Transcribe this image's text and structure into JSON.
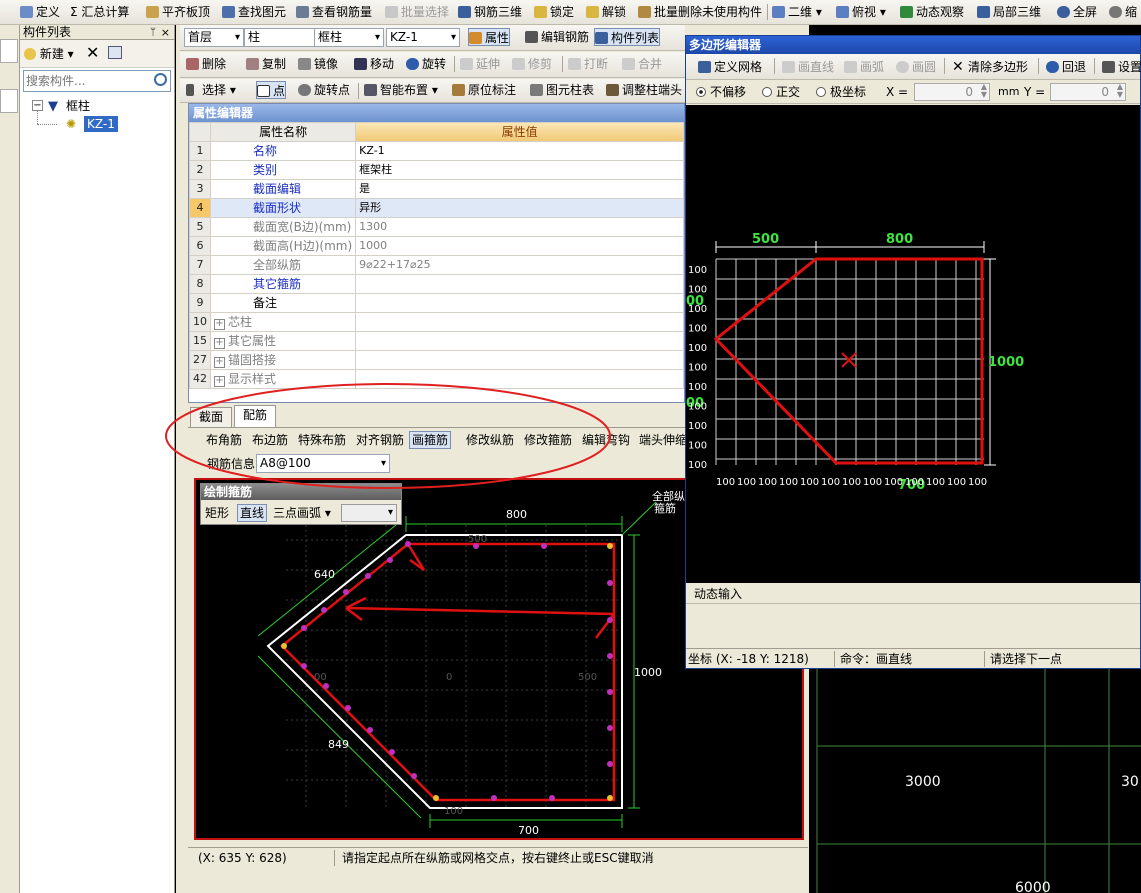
{
  "top_toolbar": {
    "items": [
      {
        "label": "定义",
        "icon": "define-icon"
      },
      {
        "label": "Σ 汇总计算",
        "icon": "sum-icon"
      },
      {
        "label": "平齐板顶",
        "icon": "align-slab-icon"
      },
      {
        "label": "查找图元",
        "icon": "find-icon"
      },
      {
        "label": "查看钢筋量",
        "icon": "view-rebar-icon"
      },
      {
        "label": "批量选择",
        "icon": "batch-select-icon",
        "disabled": true
      },
      {
        "label": "钢筋三维",
        "icon": "rebar-3d-icon"
      },
      {
        "label": "锁定",
        "icon": "lock-icon"
      },
      {
        "label": "解锁",
        "icon": "unlock-icon"
      },
      {
        "label": "批量删除未使用构件",
        "icon": "batch-delete-icon"
      },
      {
        "label": "二维",
        "icon": "2d-icon"
      },
      {
        "label": "俯视",
        "icon": "top-view-icon"
      },
      {
        "label": "动态观察",
        "icon": "orbit-icon"
      },
      {
        "label": "局部三维",
        "icon": "local-3d-icon"
      },
      {
        "label": "全屏",
        "icon": "fullscreen-icon"
      },
      {
        "label": "缩",
        "icon": "zoom-icon"
      }
    ]
  },
  "left_panel": {
    "title": "构件列表",
    "new_label": "新建",
    "search_placeholder": "搜索构件...",
    "tree_root": "框柱",
    "tree_child": "KZ-1"
  },
  "second_toolbar": {
    "floor": "首层",
    "type": "柱",
    "subtype": "框柱",
    "component": "KZ-1",
    "btn_props": "属性",
    "btn_edit_rebar": "编辑钢筋",
    "btn_component_list": "构件列表"
  },
  "third_toolbar": {
    "items": [
      "删除",
      "复制",
      "镜像",
      "移动",
      "旋转",
      "延伸",
      "修剪",
      "打断",
      "合并"
    ]
  },
  "fourth_toolbar": {
    "items": [
      "选择",
      "点",
      "旋转点",
      "智能布置",
      "原位标注",
      "图元柱表",
      "调整柱端头"
    ]
  },
  "property_editor": {
    "title": "属性编辑器",
    "col_name": "属性名称",
    "col_value": "属性值",
    "rows": [
      {
        "num": "1",
        "name": "名称",
        "value": "KZ-1",
        "style": "blue"
      },
      {
        "num": "2",
        "name": "类别",
        "value": "框架柱",
        "style": "blue"
      },
      {
        "num": "3",
        "name": "截面编辑",
        "value": "是",
        "style": "blue"
      },
      {
        "num": "4",
        "name": "截面形状",
        "value": "异形",
        "style": "blue"
      },
      {
        "num": "5",
        "name": "截面宽(B边)(mm)",
        "value": "1300",
        "style": "gray"
      },
      {
        "num": "6",
        "name": "截面高(H边)(mm)",
        "value": "1000",
        "style": "gray"
      },
      {
        "num": "7",
        "name": "全部纵筋",
        "value": "9⌀22+17⌀25",
        "style": "gray"
      },
      {
        "num": "8",
        "name": "其它箍筋",
        "value": "",
        "style": "blue"
      },
      {
        "num": "9",
        "name": "备注",
        "value": "",
        "style": "black"
      },
      {
        "num": "10",
        "name": "芯柱",
        "value": "",
        "style": "gray",
        "expand": true
      },
      {
        "num": "15",
        "name": "其它属性",
        "value": "",
        "style": "gray",
        "expand": true
      },
      {
        "num": "27",
        "name": "锚固搭接",
        "value": "",
        "style": "gray",
        "expand": true
      },
      {
        "num": "42",
        "name": "显示样式",
        "value": "",
        "style": "gray",
        "expand": true
      }
    ]
  },
  "section_tabs": {
    "tabs": [
      "截面",
      "配筋"
    ],
    "buttons": [
      "布角筋",
      "布边筋",
      "特殊布筋",
      "对齐钢筋",
      "画箍筋",
      "修改纵筋",
      "修改箍筋",
      "编辑弯钩",
      "端头伸缩"
    ],
    "rebar_info_label": "钢筋信息",
    "rebar_info_value": "A8@100"
  },
  "draw_stirrup": {
    "title": "绘制箍筋",
    "btn_rect": "矩形",
    "btn_line": "直线",
    "btn_arc": "三点画弧",
    "dims": {
      "top": "800",
      "left_top": "640",
      "left_bottom": "849",
      "bottom": "700",
      "right": "1000",
      "inner_right": "500",
      "inner_left": "00",
      "inner_top": "500",
      "inner_bottom": "100",
      "inner_mid": "0"
    },
    "label_all": "全部纵",
    "label_stirrup": "箍筋"
  },
  "bottom_status": {
    "coords": "(X: 635 Y: 628)",
    "message": "请指定起点所在纵筋或网格交点，按右键终止或ESC键取消"
  },
  "polygon_editor": {
    "title": "多边形编辑器",
    "toolbar": [
      "定义网格",
      "画直线",
      "画弧",
      "画圆",
      "清除多边形",
      "回退",
      "设置"
    ],
    "offset_opts": [
      "不偏移",
      "正交",
      "极坐标"
    ],
    "x_label": "X =",
    "x_value": "0",
    "y_label": "Y =",
    "y_value": "0",
    "unit": "mm",
    "dims_top": [
      "500",
      "800"
    ],
    "dim_right": "1000",
    "dim_bottom": "700",
    "dim_left_a": "00",
    "dim_left_b": "00",
    "grid_label": "100",
    "dynamic_input_tab": "动态输入",
    "status_coords": "坐标 (X: -18 Y: 1218)",
    "status_cmd": "命令：画直线",
    "status_msg": "请选择下一点"
  },
  "canvas": {
    "label_3000": "3000",
    "label_300": "30",
    "label_6000": "6000"
  }
}
